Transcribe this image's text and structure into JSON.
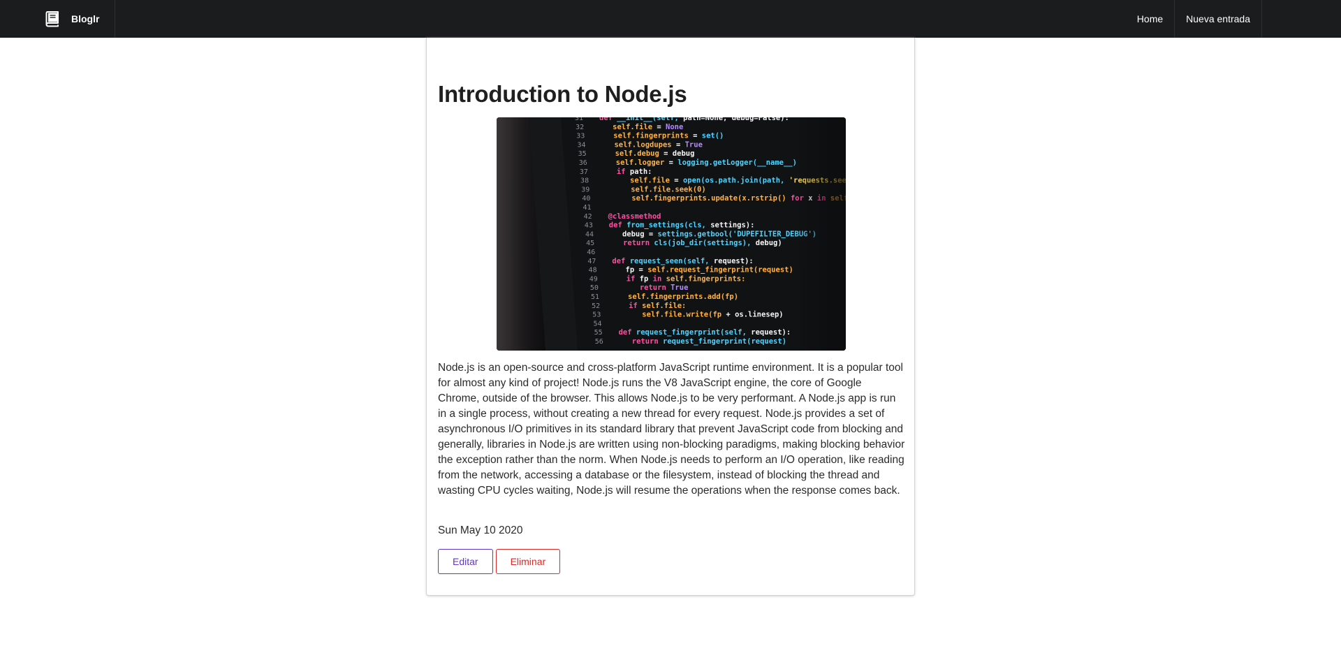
{
  "navbar": {
    "brand": "Bloglr",
    "items": [
      "Home",
      "Nueva entrada"
    ]
  },
  "post": {
    "title": "Introduction to Node.js",
    "body": "Node.js is an open-source and cross-platform JavaScript runtime environment. It is a popular tool for almost any kind of project! Node.js runs the V8 JavaScript engine, the core of Google Chrome, outside of the browser. This allows Node.js to be very performant. A Node.js app is run in a single process, without creating a new thread for every request. Node.js provides a set of asynchronous I/O primitives in its standard library that prevent JavaScript code from blocking and generally, libraries in Node.js are written using non-blocking paradigms, making blocking behavior the exception rather than the norm. When Node.js needs to perform an I/O operation, like reading from the network, accessing a database or the filesystem, instead of blocking the thread and wasting CPU cycles waiting, Node.js will resume the operations when the response comes back.",
    "date": "Sun May 10 2020",
    "image_icon": "code-screen-photo",
    "code_lines": [
      {
        "n": "31",
        "t": "def __init__(self, path=None, debug=False):"
      },
      {
        "n": "32",
        "t": "self.file = None"
      },
      {
        "n": "33",
        "t": "self.fingerprints = set()"
      },
      {
        "n": "34",
        "t": "self.logdupes = True"
      },
      {
        "n": "35",
        "t": "self.debug = debug"
      },
      {
        "n": "36",
        "t": "self.logger = logging.getLogger(__name__)"
      },
      {
        "n": "37",
        "t": "if path:"
      },
      {
        "n": "38",
        "t": "self.file = open(os.path.join(path, 'requests.seen'), 'a+')"
      },
      {
        "n": "39",
        "t": "self.file.seek(0)"
      },
      {
        "n": "40",
        "t": "self.fingerprints.update(x.rstrip() for x in self.file)"
      },
      {
        "n": "41",
        "t": ""
      },
      {
        "n": "42",
        "t": "@classmethod"
      },
      {
        "n": "43",
        "t": "def from_settings(cls, settings):"
      },
      {
        "n": "44",
        "t": "debug = settings.getbool('DUPEFILTER_DEBUG')"
      },
      {
        "n": "45",
        "t": "return cls(job_dir(settings), debug)"
      },
      {
        "n": "46",
        "t": ""
      },
      {
        "n": "47",
        "t": "def request_seen(self, request):"
      },
      {
        "n": "48",
        "t": "fp = self.request_fingerprint(request)"
      },
      {
        "n": "49",
        "t": "if fp in self.fingerprints:"
      },
      {
        "n": "50",
        "t": "return True"
      },
      {
        "n": "51",
        "t": "self.fingerprints.add(fp)"
      },
      {
        "n": "52",
        "t": "if self.file:"
      },
      {
        "n": "53",
        "t": "self.file.write(fp + os.linesep)"
      },
      {
        "n": "54",
        "t": ""
      },
      {
        "n": "55",
        "t": "def request_fingerprint(self, request):"
      },
      {
        "n": "56",
        "t": "return request_fingerprint(request)"
      }
    ]
  },
  "actions": {
    "edit_label": "Editar",
    "delete_label": "Eliminar"
  },
  "colors": {
    "navbar_bg": "#1b1c1d",
    "edit": "#6435c9",
    "delete": "#db2828"
  }
}
